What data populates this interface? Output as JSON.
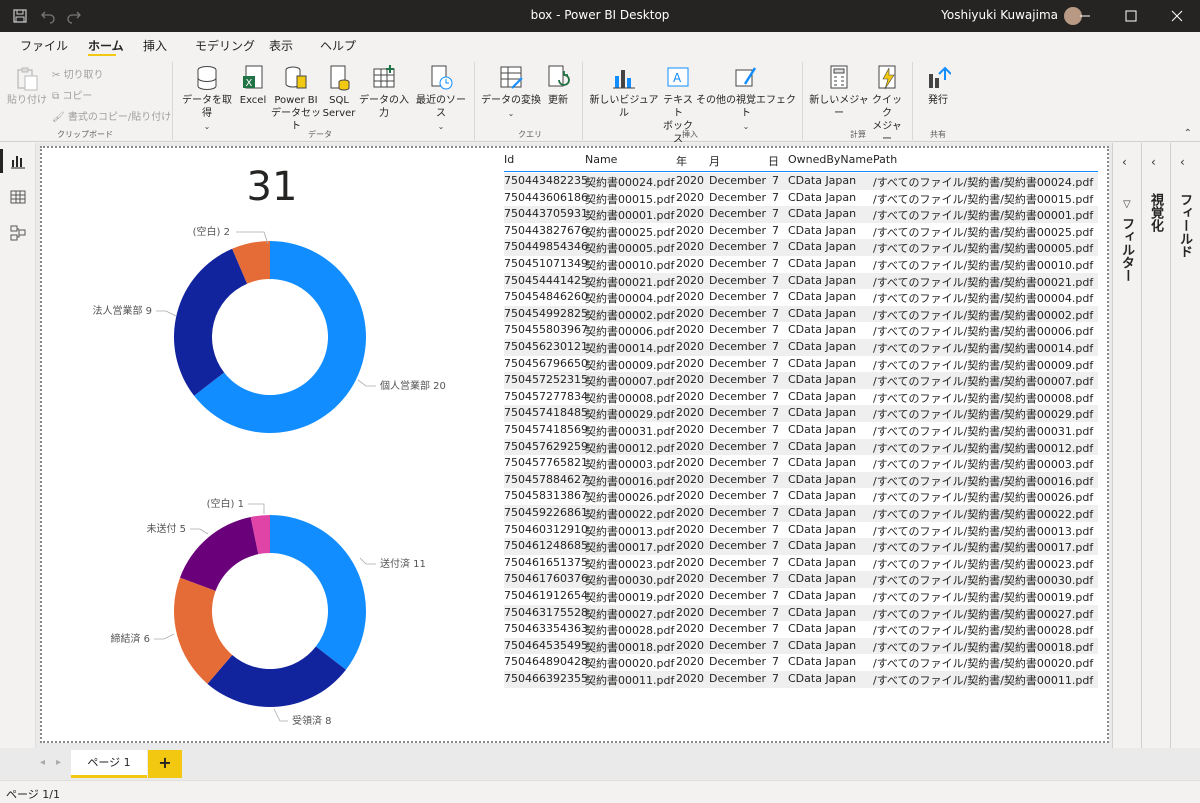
{
  "window": {
    "title": "box - Power BI Desktop",
    "user": "Yoshiyuki Kuwajima"
  },
  "menu": [
    "ファイル",
    "ホーム",
    "挿入",
    "モデリング",
    "表示",
    "ヘルプ"
  ],
  "ribbon": {
    "clipboard": {
      "paste": "貼り付け",
      "cut": "切り取り",
      "copy": "コピー",
      "format_copy": "書式のコピー/貼り付け",
      "group": "クリップボード"
    },
    "data": {
      "get_data": "データを取得",
      "excel": "Excel",
      "pbi_dataset_1": "Power BI",
      "pbi_dataset_2": "データセット",
      "sql_1": "SQL",
      "sql_2": "Server",
      "enter_data": "データの入力",
      "recent": "最近のソース",
      "group": "データ"
    },
    "query": {
      "transform": "データの変換",
      "refresh": "更新",
      "group": "クエリ"
    },
    "insert": {
      "new_visual": "新しいビジュアル",
      "textbox_1": "テキスト",
      "textbox_2": "ボックス",
      "more_visuals": "その他の視覚エフェクト",
      "group": "挿入"
    },
    "calc": {
      "new_measure": "新しいメジャー",
      "quick_measure_1": "クイック",
      "quick_measure_2": "メジャー",
      "group": "計算"
    },
    "share": {
      "publish": "発行",
      "group": "共有"
    }
  },
  "card": {
    "value": "31"
  },
  "donut1": {
    "slices": [
      {
        "label": "個人営業部",
        "value": 20,
        "color": "#118dff"
      },
      {
        "label": "法人営業部",
        "value": 9,
        "color": "#12239e"
      },
      {
        "label": "(空白)",
        "value": 2,
        "color": "#e66c37"
      }
    ],
    "labels": {
      "a": "(空白) 2",
      "b": "法人営業部 9",
      "c": "個人営業部 20"
    }
  },
  "donut2": {
    "slices": [
      {
        "label": "送付済",
        "value": 11,
        "color": "#118dff"
      },
      {
        "label": "受領済",
        "value": 8,
        "color": "#12239e"
      },
      {
        "label": "締結済",
        "value": 6,
        "color": "#e66c37"
      },
      {
        "label": "未送付",
        "value": 5,
        "color": "#6b007b"
      },
      {
        "label": "(空白)",
        "value": 1,
        "color": "#e044a7"
      }
    ],
    "labels": {
      "a": "(空白) 1",
      "b": "未送付 5",
      "c": "送付済 11",
      "d": "締結済 6",
      "e": "受領済 8"
    }
  },
  "table": {
    "headers": [
      "Id",
      "Name",
      "年",
      "月",
      "日",
      "OwnedByName",
      "Path"
    ],
    "rows": [
      [
        "750443482235",
        "契約書00024.pdf",
        "2020",
        "December",
        "7",
        "CData Japan",
        "/すべてのファイル/契約書/契約書00024.pdf"
      ],
      [
        "750443606186",
        "契約書00015.pdf",
        "2020",
        "December",
        "7",
        "CData Japan",
        "/すべてのファイル/契約書/契約書00015.pdf"
      ],
      [
        "750443705931",
        "契約書00001.pdf",
        "2020",
        "December",
        "7",
        "CData Japan",
        "/すべてのファイル/契約書/契約書00001.pdf"
      ],
      [
        "750443827676",
        "契約書00025.pdf",
        "2020",
        "December",
        "7",
        "CData Japan",
        "/すべてのファイル/契約書/契約書00025.pdf"
      ],
      [
        "750449854346",
        "契約書00005.pdf",
        "2020",
        "December",
        "7",
        "CData Japan",
        "/すべてのファイル/契約書/契約書00005.pdf"
      ],
      [
        "750451071349",
        "契約書00010.pdf",
        "2020",
        "December",
        "7",
        "CData Japan",
        "/すべてのファイル/契約書/契約書00010.pdf"
      ],
      [
        "750454441425",
        "契約書00021.pdf",
        "2020",
        "December",
        "7",
        "CData Japan",
        "/すべてのファイル/契約書/契約書00021.pdf"
      ],
      [
        "750454846260",
        "契約書00004.pdf",
        "2020",
        "December",
        "7",
        "CData Japan",
        "/すべてのファイル/契約書/契約書00004.pdf"
      ],
      [
        "750454992825",
        "契約書00002.pdf",
        "2020",
        "December",
        "7",
        "CData Japan",
        "/すべてのファイル/契約書/契約書00002.pdf"
      ],
      [
        "750455803967",
        "契約書00006.pdf",
        "2020",
        "December",
        "7",
        "CData Japan",
        "/すべてのファイル/契約書/契約書00006.pdf"
      ],
      [
        "750456230121",
        "契約書00014.pdf",
        "2020",
        "December",
        "7",
        "CData Japan",
        "/すべてのファイル/契約書/契約書00014.pdf"
      ],
      [
        "750456796650",
        "契約書00009.pdf",
        "2020",
        "December",
        "7",
        "CData Japan",
        "/すべてのファイル/契約書/契約書00009.pdf"
      ],
      [
        "750457252315",
        "契約書00007.pdf",
        "2020",
        "December",
        "7",
        "CData Japan",
        "/すべてのファイル/契約書/契約書00007.pdf"
      ],
      [
        "750457277834",
        "契約書00008.pdf",
        "2020",
        "December",
        "7",
        "CData Japan",
        "/すべてのファイル/契約書/契約書00008.pdf"
      ],
      [
        "750457418485",
        "契約書00029.pdf",
        "2020",
        "December",
        "7",
        "CData Japan",
        "/すべてのファイル/契約書/契約書00029.pdf"
      ],
      [
        "750457418569",
        "契約書00031.pdf",
        "2020",
        "December",
        "7",
        "CData Japan",
        "/すべてのファイル/契約書/契約書00031.pdf"
      ],
      [
        "750457629259",
        "契約書00012.pdf",
        "2020",
        "December",
        "7",
        "CData Japan",
        "/すべてのファイル/契約書/契約書00012.pdf"
      ],
      [
        "750457765821",
        "契約書00003.pdf",
        "2020",
        "December",
        "7",
        "CData Japan",
        "/すべてのファイル/契約書/契約書00003.pdf"
      ],
      [
        "750457884627",
        "契約書00016.pdf",
        "2020",
        "December",
        "7",
        "CData Japan",
        "/すべてのファイル/契約書/契約書00016.pdf"
      ],
      [
        "750458313867",
        "契約書00026.pdf",
        "2020",
        "December",
        "7",
        "CData Japan",
        "/すべてのファイル/契約書/契約書00026.pdf"
      ],
      [
        "750459226861",
        "契約書00022.pdf",
        "2020",
        "December",
        "7",
        "CData Japan",
        "/すべてのファイル/契約書/契約書00022.pdf"
      ],
      [
        "750460312910",
        "契約書00013.pdf",
        "2020",
        "December",
        "7",
        "CData Japan",
        "/すべてのファイル/契約書/契約書00013.pdf"
      ],
      [
        "750461248685",
        "契約書00017.pdf",
        "2020",
        "December",
        "7",
        "CData Japan",
        "/すべてのファイル/契約書/契約書00017.pdf"
      ],
      [
        "750461651375",
        "契約書00023.pdf",
        "2020",
        "December",
        "7",
        "CData Japan",
        "/すべてのファイル/契約書/契約書00023.pdf"
      ],
      [
        "750461760376",
        "契約書00030.pdf",
        "2020",
        "December",
        "7",
        "CData Japan",
        "/すべてのファイル/契約書/契約書00030.pdf"
      ],
      [
        "750461912654",
        "契約書00019.pdf",
        "2020",
        "December",
        "7",
        "CData Japan",
        "/すべてのファイル/契約書/契約書00019.pdf"
      ],
      [
        "750463175528",
        "契約書00027.pdf",
        "2020",
        "December",
        "7",
        "CData Japan",
        "/すべてのファイル/契約書/契約書00027.pdf"
      ],
      [
        "750463354363",
        "契約書00028.pdf",
        "2020",
        "December",
        "7",
        "CData Japan",
        "/すべてのファイル/契約書/契約書00028.pdf"
      ],
      [
        "750464535495",
        "契約書00018.pdf",
        "2020",
        "December",
        "7",
        "CData Japan",
        "/すべてのファイル/契約書/契約書00018.pdf"
      ],
      [
        "750464890428",
        "契約書00020.pdf",
        "2020",
        "December",
        "7",
        "CData Japan",
        "/すべてのファイル/契約書/契約書00020.pdf"
      ],
      [
        "750466392355",
        "契約書00011.pdf",
        "2020",
        "December",
        "7",
        "CData Japan",
        "/すべてのファイル/契約書/契約書00011.pdf"
      ]
    ]
  },
  "panes": {
    "filters": "フィルター",
    "visualizations": "視覚化",
    "fields": "フィールド"
  },
  "pages": {
    "tab": "ページ 1",
    "add": "+"
  },
  "status": "ページ 1/1",
  "chart_data": [
    {
      "type": "pie",
      "categories": [
        "個人営業部",
        "法人営業部",
        "(空白)"
      ],
      "values": [
        20,
        9,
        2
      ],
      "title": ""
    },
    {
      "type": "pie",
      "categories": [
        "送付済",
        "受領済",
        "締結済",
        "未送付",
        "(空白)"
      ],
      "values": [
        11,
        8,
        6,
        5,
        1
      ],
      "title": ""
    }
  ]
}
